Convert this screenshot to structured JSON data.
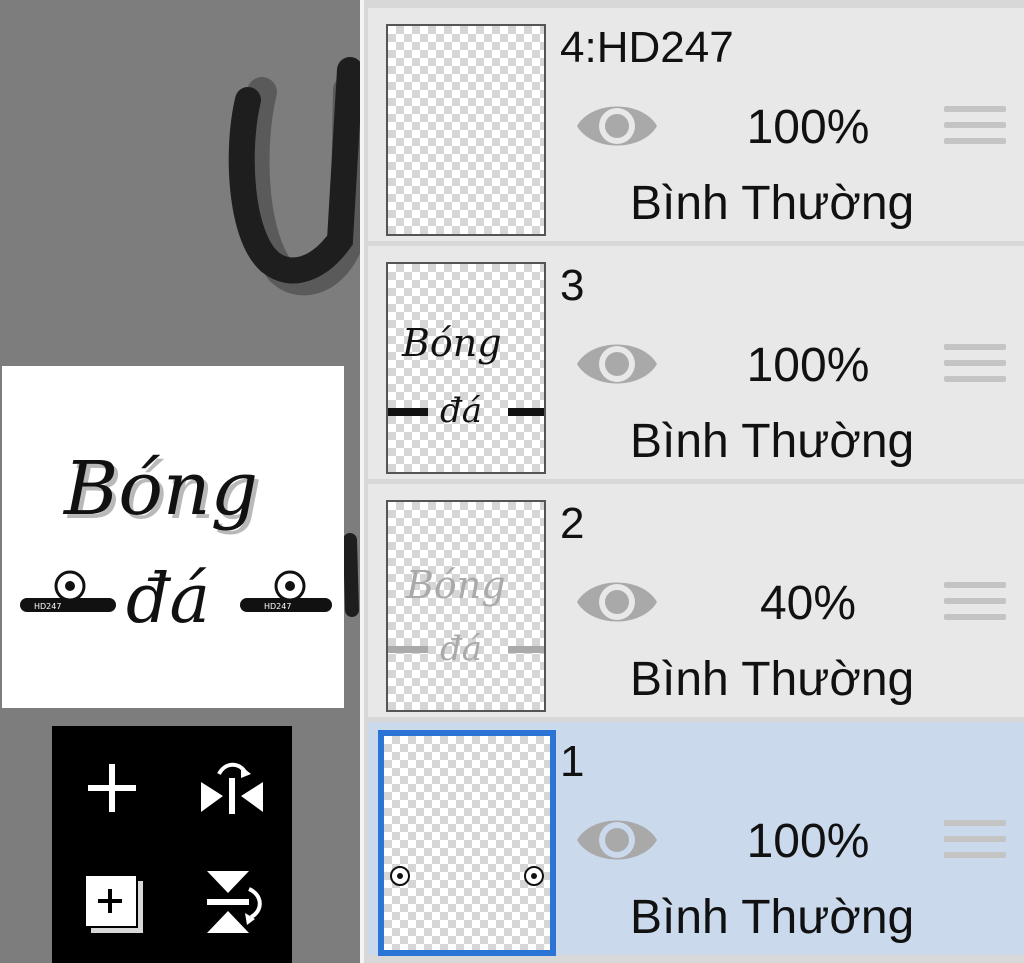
{
  "canvas": {
    "preview_text_line1": "Bóng",
    "preview_text_line2": "đá",
    "preview_badge_left": "HD247",
    "preview_badge_right": "HD247"
  },
  "tools": [
    {
      "name": "add-layer",
      "icon": "plus-icon"
    },
    {
      "name": "flip-horizontal",
      "icon": "flip-horizontal-icon"
    },
    {
      "name": "duplicate-layer",
      "icon": "duplicate-layer-icon"
    },
    {
      "name": "flip-vertical",
      "icon": "flip-vertical-icon"
    }
  ],
  "layers": [
    {
      "name": "4:HD247",
      "visible": true,
      "opacity": "100%",
      "blend_mode": "Bình Thường",
      "selected": false
    },
    {
      "name": "3",
      "visible": true,
      "opacity": "100%",
      "blend_mode": "Bình Thường",
      "selected": false
    },
    {
      "name": "2",
      "visible": true,
      "opacity": "40%",
      "blend_mode": "Bình Thường",
      "selected": false
    },
    {
      "name": "1",
      "visible": true,
      "opacity": "100%",
      "blend_mode": "Bình Thường",
      "selected": true
    }
  ],
  "colors": {
    "canvas_bg": "#7d7d7d",
    "panel_bg": "#e8e8e8",
    "selected_bg": "#cbd9ed",
    "selected_border": "#2b74d6",
    "icon_gray": "#a9a9a9"
  }
}
